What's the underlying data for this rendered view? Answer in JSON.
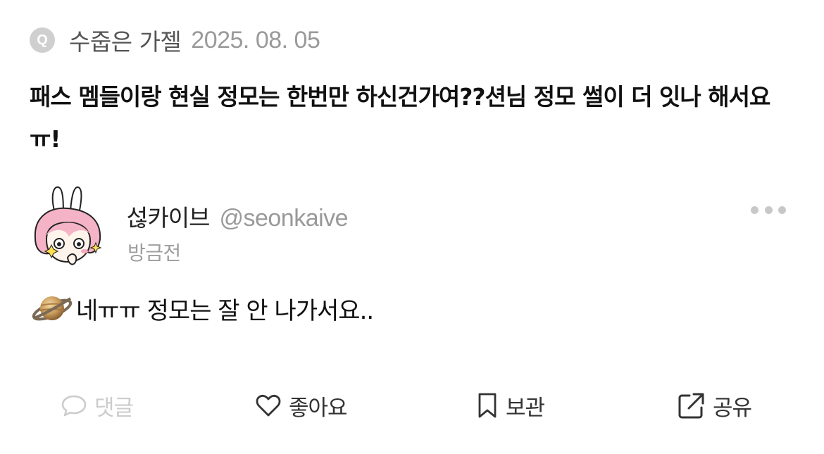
{
  "question": {
    "badge": "Q",
    "author": "수줍은 가젤",
    "date": "2025. 08. 05",
    "text": "패스 멤들이랑 현실 정모는 한번만 하신건가여??션님 정모 썰이 더 잇나 해서요ㅠ!"
  },
  "answer": {
    "name": "섢카이브",
    "handle": "@seonkaive",
    "time": "방금전",
    "text": "네ㅠㅠ 정모는 잘 안 나가서요.."
  },
  "actions": {
    "comment": "댓글",
    "like": "좋아요",
    "save": "보관",
    "share": "공유"
  },
  "icons": [
    "more-icon",
    "planet-icon",
    "comment-icon",
    "heart-icon",
    "bookmark-icon",
    "share-icon"
  ],
  "colors": {
    "muted": "#9a9a9a",
    "disabled": "#cccccc",
    "avatar_hair": "#f4b3c6"
  }
}
